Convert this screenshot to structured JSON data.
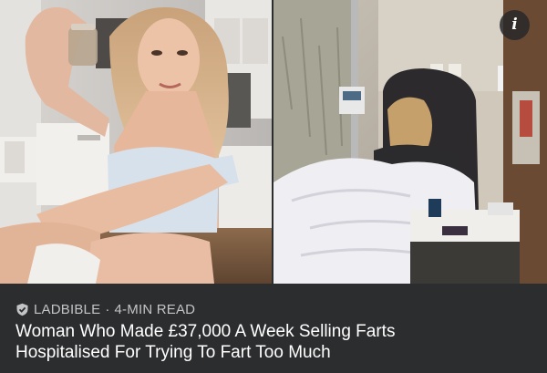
{
  "buttons": {
    "info_label": "i"
  },
  "article": {
    "source": "LADBIBLE",
    "separator": "·",
    "read_time": "4-MIN READ",
    "headline_line1": "Woman Who Made £37,000 A Week Selling Farts",
    "headline_line2": "Hospitalised For Trying To Fart Too Much"
  },
  "icons": {
    "source_icon": "shield-check-icon",
    "info": "info-icon"
  },
  "colors": {
    "card_background": "#2c2d2f",
    "meta_text": "#c3c4c6",
    "headline_text": "#ffffff"
  }
}
